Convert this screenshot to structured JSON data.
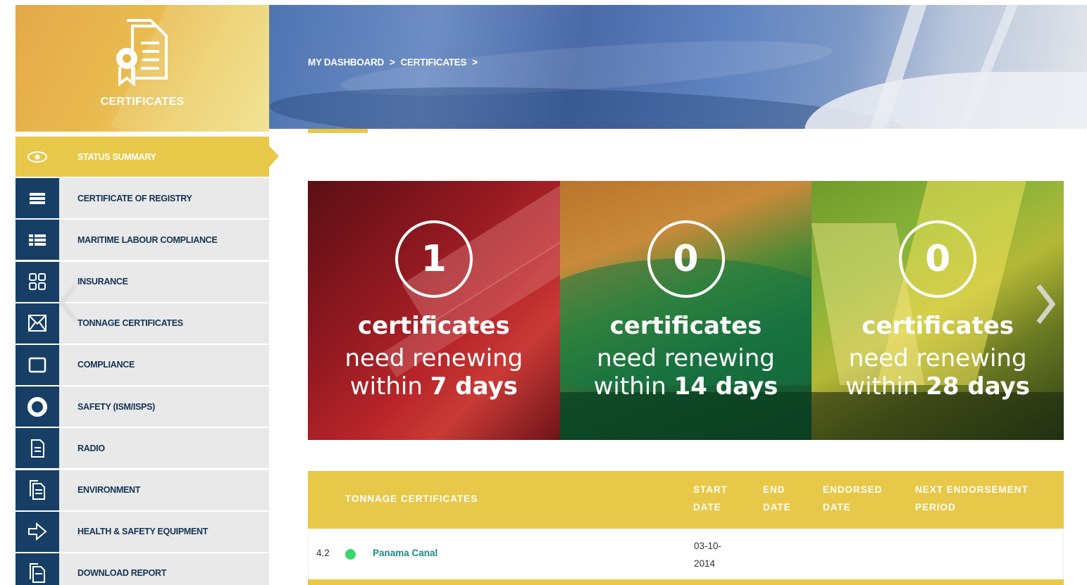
{
  "sidebar": {
    "brand_title": "CERTIFICATES",
    "brand_icon": "certificate-icon",
    "items": [
      {
        "label": "STATUS SUMMARY",
        "icon": "eye-icon",
        "active": true
      },
      {
        "label": "CERTIFICATE OF REGISTRY",
        "icon": "list-icon"
      },
      {
        "label": "MARITIME LABOUR COMPLIANCE",
        "icon": "detailed-list-icon"
      },
      {
        "label": "INSURANCE",
        "icon": "grid-icon"
      },
      {
        "label": "TONNAGE CERTIFICATES",
        "icon": "envelope-icon"
      },
      {
        "label": "COMPLIANCE",
        "icon": "square-icon"
      },
      {
        "label": "SAFETY (ISM/ISPS)",
        "icon": "lifebuoy-icon"
      },
      {
        "label": "RADIO",
        "icon": "document-icon"
      },
      {
        "label": "ENVIRONMENT",
        "icon": "documents-icon"
      },
      {
        "label": "HEALTH & SAFETY EQUIPMENT",
        "icon": "arrow-right-icon"
      },
      {
        "label": "DOWNLOAD REPORT",
        "icon": "report-icon"
      }
    ]
  },
  "header": {
    "breadcrumb": [
      "MY DASHBOARD",
      ">",
      "CERTIFICATES",
      ">"
    ]
  },
  "tiles": [
    {
      "count": "1",
      "heading": "certificates",
      "line1": "need renewing",
      "within": "within",
      "days": "7 days"
    },
    {
      "count": "0",
      "heading": "certificates",
      "line1": "need renewing",
      "within": "within",
      "days": "14 days"
    },
    {
      "count": "0",
      "heading": "certificates",
      "line1": "need renewing",
      "within": "within",
      "days": "28 days"
    }
  ],
  "table": {
    "headers": {
      "name": "TONNAGE CERTIFICATES",
      "start_1": "START",
      "start_2": "DATE",
      "end_1": "END",
      "end_2": "DATE",
      "endorsed_1": "ENDORSED",
      "endorsed_2": "DATE",
      "next_1": "NEXT ENDORSEMENT",
      "next_2": "PERIOD"
    },
    "rows": [
      {
        "num": "4.2",
        "status_color": "#3ad66a",
        "name": "Panama Canal",
        "start_1": "03-10-",
        "start_2": "2014",
        "end": "",
        "endorsed": "",
        "next": ""
      }
    ]
  },
  "colors": {
    "accent": "#e8c848",
    "nav_dark": "#173f66",
    "nav_bg": "#e9e9e9",
    "link": "#1a8a86"
  }
}
